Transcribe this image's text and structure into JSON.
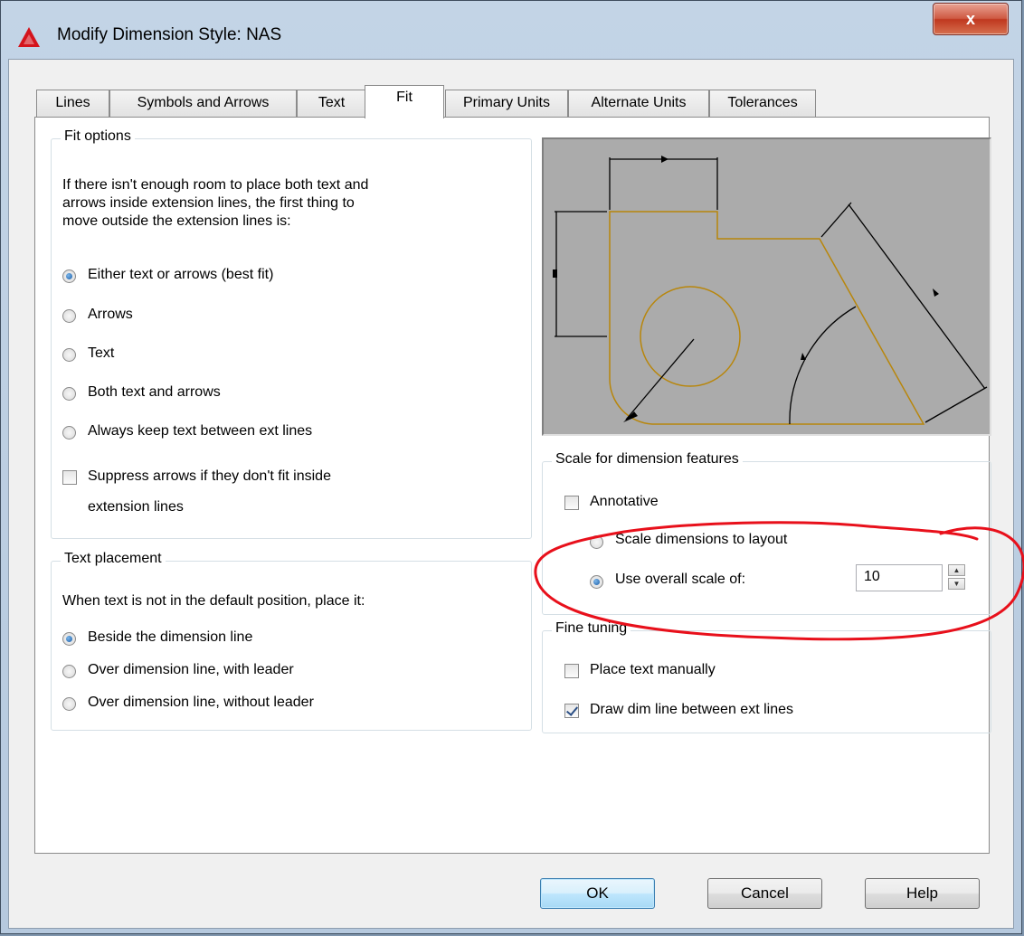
{
  "window": {
    "title": "Modify Dimension Style: NAS",
    "close_symbol": "x"
  },
  "tabs": [
    {
      "label": "Lines",
      "active": false
    },
    {
      "label": "Symbols and Arrows",
      "active": false
    },
    {
      "label": "Text",
      "active": false
    },
    {
      "label": "Fit",
      "active": true
    },
    {
      "label": "Primary Units",
      "active": false
    },
    {
      "label": "Alternate Units",
      "active": false
    },
    {
      "label": "Tolerances",
      "active": false
    }
  ],
  "fit_options": {
    "title": "Fit options",
    "description": [
      "If there isn't enough room to place both text and",
      "arrows inside extension lines, the first thing to",
      "move outside the extension lines is:"
    ],
    "options": [
      {
        "label": "Either text or arrows (best fit)",
        "selected": true
      },
      {
        "label": "Arrows",
        "selected": false
      },
      {
        "label": "Text",
        "selected": false
      },
      {
        "label": "Both text and arrows",
        "selected": false
      },
      {
        "label": "Always keep text between ext lines",
        "selected": false
      }
    ],
    "suppress_arrows": {
      "label_line1": "Suppress arrows if they don't fit inside",
      "label_line2": "extension lines",
      "checked": false
    }
  },
  "text_placement": {
    "title": "Text placement",
    "description": "When text is not in the default position, place it:",
    "options": [
      {
        "label": "Beside the dimension line",
        "selected": true
      },
      {
        "label": "Over dimension line, with leader",
        "selected": false
      },
      {
        "label": "Over dimension line, without leader",
        "selected": false
      }
    ]
  },
  "scale": {
    "title": "Scale for dimension features",
    "annotative": {
      "label": "Annotative",
      "checked": false
    },
    "layout": {
      "label": "Scale dimensions to layout",
      "selected": false
    },
    "overall": {
      "label": "Use overall scale of:",
      "selected": true,
      "value": "10"
    }
  },
  "fine_tuning": {
    "title": "Fine tuning",
    "place_manually": {
      "label": "Place text manually",
      "checked": false
    },
    "draw_dim_line": {
      "label": "Draw dim line between ext lines",
      "checked": true
    }
  },
  "buttons": {
    "ok": "OK",
    "cancel": "Cancel",
    "help": "Help"
  },
  "colors": {
    "annotation": "#e8101b",
    "geometry": "#b8860b",
    "preview_bg": "#ababab"
  }
}
